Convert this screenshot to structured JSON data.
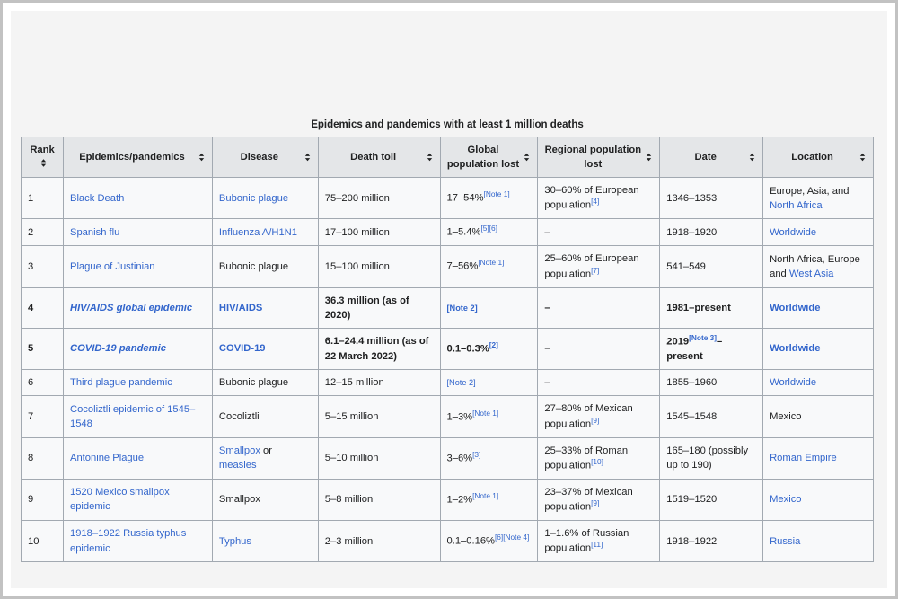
{
  "table": {
    "caption": "Epidemics and pandemics with at least 1 million deaths",
    "sort_icon_name": "sort-both-arrows-icon",
    "columns": [
      {
        "label": "Rank",
        "sortable": true
      },
      {
        "label": "Epidemics/pandemics",
        "sortable": true
      },
      {
        "label": "Disease",
        "sortable": true
      },
      {
        "label": "Death toll",
        "sortable": true
      },
      {
        "label": "Global population lost",
        "sortable": true
      },
      {
        "label": "Regional population lost",
        "sortable": true
      },
      {
        "label": "Date",
        "sortable": true
      },
      {
        "label": "Location",
        "sortable": true
      }
    ],
    "rows": [
      {
        "rank": "1",
        "name": "Black Death",
        "name_link": true,
        "disease": "Bubonic plague",
        "disease_link": true,
        "death_toll": "75–200 million",
        "global_lost": "17–54%",
        "global_refs": [
          "[Note 1]"
        ],
        "regional_lost": "30–60% of European population",
        "regional_refs": [
          "[4]"
        ],
        "date": "1346–1353",
        "location_plain_prefix": "Europe, Asia, and ",
        "location_link": "North Africa",
        "bold": false
      },
      {
        "rank": "2",
        "name": "Spanish flu",
        "name_link": true,
        "disease": "Influenza A/H1N1",
        "disease_link": true,
        "death_toll": "17–100 million",
        "global_lost": "1–5.4%",
        "global_refs": [
          "[5]",
          "[6]"
        ],
        "regional_lost": "–",
        "regional_refs": [],
        "date": "1918–1920",
        "location_plain_prefix": "",
        "location_link": "Worldwide",
        "bold": false
      },
      {
        "rank": "3",
        "name": "Plague of Justinian",
        "name_link": true,
        "disease": "Bubonic plague",
        "disease_link": false,
        "death_toll": "15–100 million",
        "global_lost": "7–56%",
        "global_refs": [
          "[Note 1]"
        ],
        "regional_lost": "25–60% of European population",
        "regional_refs": [
          "[7]"
        ],
        "date": "541–549",
        "location_plain_prefix": "North Africa, Europe and ",
        "location_link": "West Asia",
        "bold": false
      },
      {
        "rank": "4",
        "name": "HIV/AIDS global epidemic",
        "name_link": true,
        "disease": "HIV/AIDS",
        "disease_link": true,
        "death_toll": "36.3 million (as of 2020)",
        "global_lost": "",
        "global_refs": [
          "[Note 2]"
        ],
        "regional_lost": "–",
        "regional_refs": [],
        "date": "1981–present",
        "location_plain_prefix": "",
        "location_link": "Worldwide",
        "bold": true
      },
      {
        "rank": "5",
        "name": "COVID-19 pandemic",
        "name_link": true,
        "disease": "COVID-19",
        "disease_link": true,
        "death_toll": "6.1–24.4 million (as of 22 March 2022)",
        "global_lost": "0.1–0.3%",
        "global_refs": [
          "[2]"
        ],
        "regional_lost": "–",
        "regional_refs": [],
        "date": "2019",
        "date_refs": [
          "[Note 3]"
        ],
        "date_suffix": "–present",
        "location_plain_prefix": "",
        "location_link": "Worldwide",
        "bold": true
      },
      {
        "rank": "6",
        "name": "Third plague pandemic",
        "name_link": true,
        "disease": "Bubonic plague",
        "disease_link": false,
        "death_toll": "12–15 million",
        "global_lost": "",
        "global_refs": [
          "[Note 2]"
        ],
        "regional_lost": "–",
        "regional_refs": [],
        "date": "1855–1960",
        "location_plain_prefix": "",
        "location_link": "Worldwide",
        "bold": false
      },
      {
        "rank": "7",
        "name": "Cocoliztli epidemic of 1545–1548",
        "name_link": true,
        "disease": "Cocoliztli",
        "disease_link": false,
        "death_toll": "5–15 million",
        "global_lost": "1–3%",
        "global_refs": [
          "[Note 1]"
        ],
        "regional_lost": "27–80% of Mexican population",
        "regional_refs": [
          "[9]"
        ],
        "date": "1545–1548",
        "location_plain_prefix": "Mexico",
        "location_link": "",
        "bold": false
      },
      {
        "rank": "8",
        "name": "Antonine Plague",
        "name_link": true,
        "disease": "Smallpox",
        "disease_link": true,
        "disease_mid": " or ",
        "disease2": "measles",
        "disease2_link": true,
        "death_toll": "5–10 million",
        "global_lost": "3–6%",
        "global_refs": [
          "[3]"
        ],
        "regional_lost": "25–33% of Roman population",
        "regional_refs": [
          "[10]"
        ],
        "date": "165–180 (possibly up to 190)",
        "location_plain_prefix": "",
        "location_link": "Roman Empire",
        "bold": false
      },
      {
        "rank": "9",
        "name": "1520 Mexico smallpox epidemic",
        "name_link": true,
        "disease": "Smallpox",
        "disease_link": false,
        "death_toll": "5–8 million",
        "global_lost": "1–2%",
        "global_refs": [
          "[Note 1]"
        ],
        "regional_lost": "23–37% of Mexican population",
        "regional_refs": [
          "[9]"
        ],
        "date": "1519–1520",
        "location_plain_prefix": "",
        "location_link": "Mexico",
        "bold": false
      },
      {
        "rank": "10",
        "name": "1918–1922 Russia typhus epidemic",
        "name_link": true,
        "disease": "Typhus",
        "disease_link": true,
        "death_toll": "2–3 million",
        "global_lost": "0.1–0.16%",
        "global_refs": [
          "[6]",
          "[Note 4]"
        ],
        "regional_lost": "1–1.6% of Russian population",
        "regional_refs": [
          "[11]"
        ],
        "date": "1918–1922",
        "location_plain_prefix": "",
        "location_link": "Russia",
        "bold": false
      }
    ]
  },
  "colors": {
    "link": "#3366cc",
    "text": "#202122",
    "header_bg": "#e4e6e8",
    "cell_bg": "#f8f9fa",
    "border": "#a2a9b1",
    "page_bg": "#f4f4f4",
    "frame_border": "#c2c2c2"
  }
}
